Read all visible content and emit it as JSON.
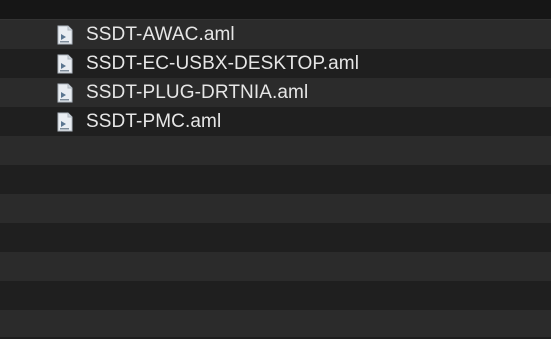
{
  "files": [
    {
      "name": "SSDT-AWAC.aml",
      "icon": "aml-file-icon"
    },
    {
      "name": "SSDT-EC-USBX-DESKTOP.aml",
      "icon": "aml-file-icon"
    },
    {
      "name": "SSDT-PLUG-DRTNIA.aml",
      "icon": "aml-file-icon"
    },
    {
      "name": "SSDT-PMC.aml",
      "icon": "aml-file-icon"
    }
  ],
  "colors": {
    "background": "#1e1e1e",
    "row_alt": "#2b2b2b",
    "text": "#e6e6e6"
  }
}
